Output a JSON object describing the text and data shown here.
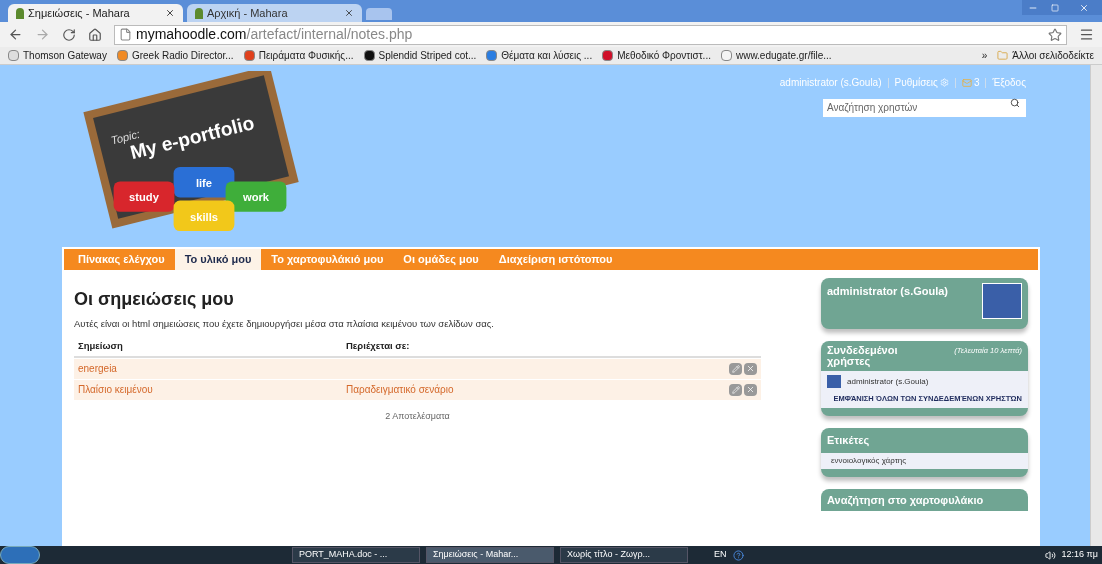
{
  "browser": {
    "tabs": [
      {
        "title": "Σημειώσεις - Mahara",
        "selected": true
      },
      {
        "title": "Αρχική - Mahara",
        "selected": false
      }
    ],
    "url": {
      "domain": "mymahoodle.com",
      "path": "/artefact/internal/notes.php"
    },
    "bookmarks": [
      {
        "label": "Thomson Gateway",
        "color": "#dddddd"
      },
      {
        "label": "Greek Radio Director...",
        "color": "#f08a24"
      },
      {
        "label": "Πειράματα Φυσικής...",
        "color": "#e0401c"
      },
      {
        "label": "Splendid Striped cot...",
        "color": "#111111"
      },
      {
        "label": "Θέματα και λύσεις ...",
        "color": "#2a7de1"
      },
      {
        "label": "Μεθοδικό Φροντιστ...",
        "color": "#d0102a"
      },
      {
        "label": "www.edugate.gr/file...",
        "color": "#f4f4f4"
      }
    ],
    "bookmarks_overflow": "»",
    "other_bookmarks": "Άλλοι σελιδοδείκτε"
  },
  "header": {
    "user": "administrator (s.Goula)",
    "settings": "Ρυθμίσεις",
    "messages": "3",
    "logout": "Έξοδος",
    "search": {
      "placeholder": "Αναζήτηση χρηστών"
    },
    "logo": {
      "topic": "Topic:",
      "title": "My e-portfolio",
      "pieces": [
        "life",
        "study",
        "work",
        "skills"
      ]
    }
  },
  "nav": [
    {
      "label": "Πίνακας ελέγχου",
      "selected": false
    },
    {
      "label": "Το υλικό μου",
      "selected": true
    },
    {
      "label": "Το χαρτοφυλάκιό μου",
      "selected": false
    },
    {
      "label": "Οι ομάδες μου",
      "selected": false
    },
    {
      "label": "Διαχείριση ιστότοπου",
      "selected": false
    }
  ],
  "main": {
    "title": "Οι σημειώσεις μου",
    "description": "Αυτές είναι οι html σημειώσεις που έχετε δημιουργήσει μέσα στα πλαίσια κειμένου των σελίδων σας.",
    "table": {
      "columns": [
        "Σημείωση",
        "Περιέχεται σε:"
      ],
      "rows": [
        {
          "note": "energeia",
          "contained_in": ""
        },
        {
          "note": "Πλαίσιο κειμένου",
          "contained_in": "Παραδειγματικό σενάριο"
        }
      ]
    },
    "results": "2 Αποτελέσματα"
  },
  "sidebar": {
    "profile": {
      "name": "administrator (s.Goula)"
    },
    "online": {
      "title": "Συνδεδεμένοι χρήστες",
      "note": "(Τελευταία 10 λεπτά)",
      "users": [
        "administrator (s.Goula)"
      ],
      "show_all": "ΕΜΦΆΝΙΣΗ ΌΛΩΝ ΤΩΝ ΣΥΝΔΕΔΕΜΈΝΩΝ ΧΡΗΣΤΏΝ"
    },
    "tags": {
      "title": "Ετικέτες",
      "items": [
        "εννοιολογικός χάρτης"
      ]
    },
    "search": {
      "title": "Αναζήτηση στο χαρτοφυλάκιο"
    }
  },
  "taskbar": {
    "tasks": [
      {
        "label": "PORT_MAHA.doc - ...",
        "selected": false
      },
      {
        "label": "Σημειώσεις - Mahar...",
        "selected": true
      },
      {
        "label": "Χωρίς τίτλο - Ζωγρ...",
        "selected": false
      }
    ],
    "language": "EN",
    "clock": "12:16 πμ"
  }
}
